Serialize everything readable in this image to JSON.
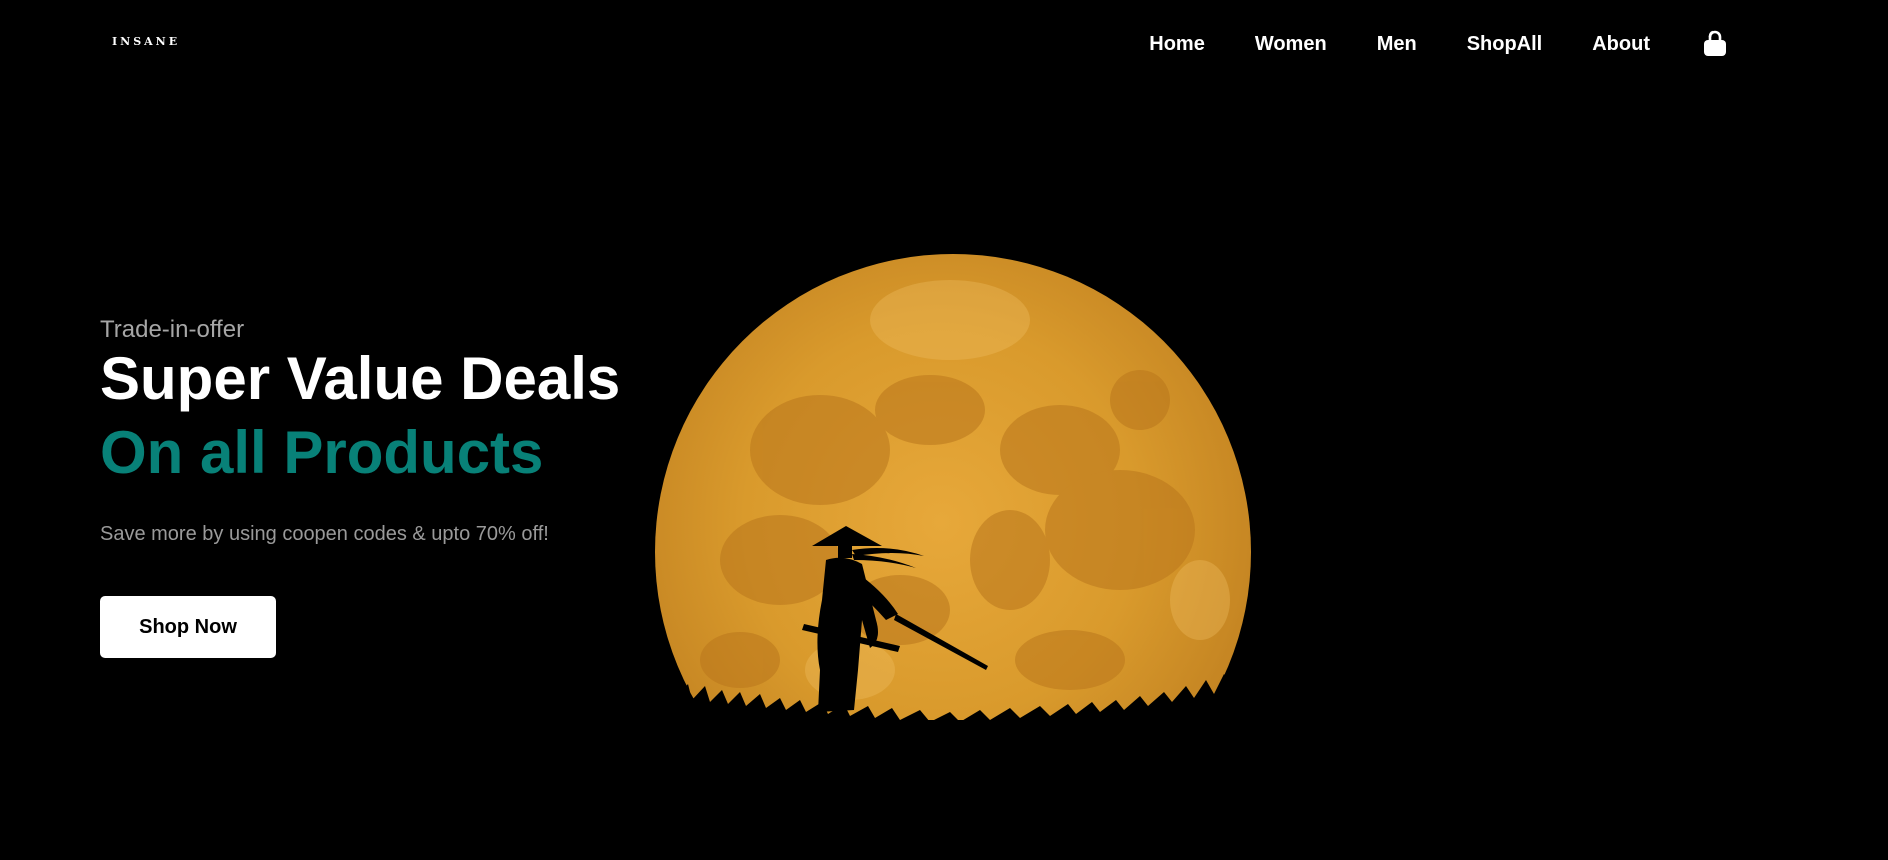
{
  "header": {
    "logo_text": "INSANE",
    "nav": [
      {
        "label": "Home"
      },
      {
        "label": "Women"
      },
      {
        "label": "Men"
      },
      {
        "label": "ShopAll"
      },
      {
        "label": "About"
      }
    ],
    "cart_icon": "shopping-bag-icon"
  },
  "hero": {
    "eyebrow": "Trade-in-offer",
    "headline": "Super Value Deals",
    "headline_accent": "On all Products",
    "subtext": "Save more by using coopen codes & upto 70% off!",
    "cta_label": "Shop Now",
    "illustration": "samurai-moon-image"
  },
  "colors": {
    "background": "#000000",
    "accent": "#088178",
    "moon": "#e0a032",
    "text_primary": "#ffffff",
    "text_muted": "#a6a6a6"
  }
}
